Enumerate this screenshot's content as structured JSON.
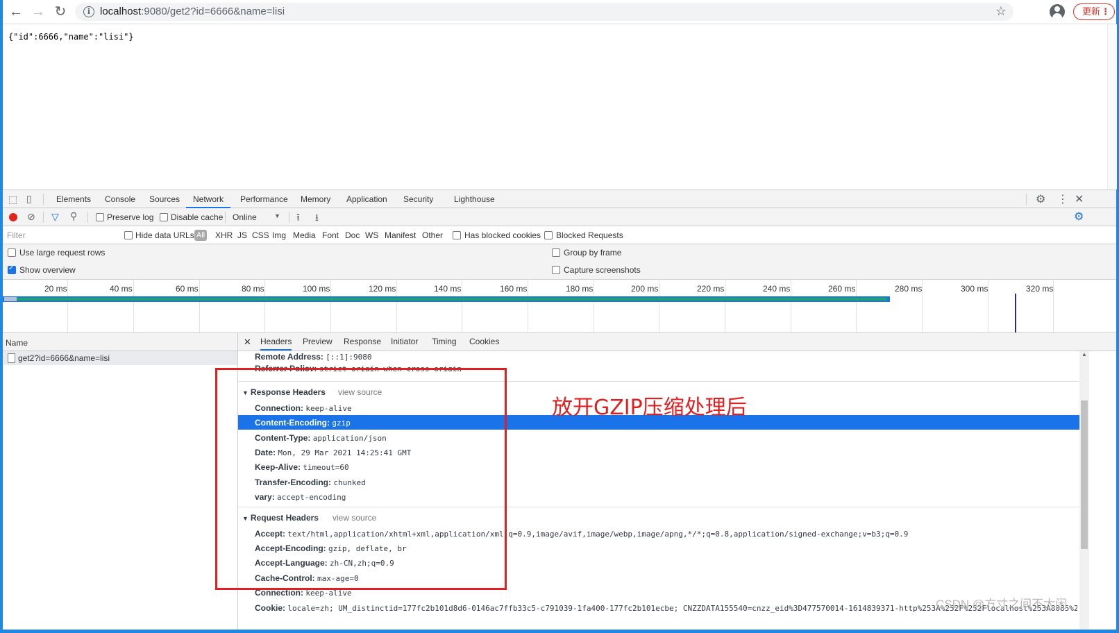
{
  "browser": {
    "url_host": "localhost",
    "url_rest": ":9080/get2?id=6666&name=lisi",
    "update_label": "更新"
  },
  "page": {
    "json_text": "{\"id\":6666,\"name\":\"lisi\"}"
  },
  "devtools": {
    "tabs": [
      "Elements",
      "Console",
      "Sources",
      "Network",
      "Performance",
      "Memory",
      "Application",
      "Security",
      "Lighthouse"
    ],
    "active_tab": "Network",
    "toolbar": {
      "preserve_log": "Preserve log",
      "disable_cache": "Disable cache",
      "throttle": "Online"
    },
    "filter": {
      "placeholder": "Filter",
      "hide_data_urls": "Hide data URLs",
      "types": [
        "All",
        "XHR",
        "JS",
        "CSS",
        "Img",
        "Media",
        "Font",
        "Doc",
        "WS",
        "Manifest",
        "Other"
      ],
      "has_blocked_cookies": "Has blocked cookies",
      "blocked_requests": "Blocked Requests"
    },
    "options": {
      "use_large_rows": "Use large request rows",
      "show_overview": "Show overview",
      "group_by_frame": "Group by frame",
      "capture_screenshots": "Capture screenshots"
    },
    "timeline_ticks": [
      "20 ms",
      "40 ms",
      "60 ms",
      "80 ms",
      "100 ms",
      "120 ms",
      "140 ms",
      "160 ms",
      "180 ms",
      "200 ms",
      "220 ms",
      "240 ms",
      "260 ms",
      "280 ms",
      "300 ms",
      "320 ms"
    ],
    "requests_header": "Name",
    "requests": [
      "get2?id=6666&name=lisi"
    ],
    "detail_tabs": [
      "Headers",
      "Preview",
      "Response",
      "Initiator",
      "Timing",
      "Cookies"
    ],
    "general_partial": [
      {
        "k": "Remote Address:",
        "v": "[::1]:9080"
      },
      {
        "k": "Referrer Policy:",
        "v": "strict-origin-when-cross-origin"
      }
    ],
    "response_headers_title": "Response Headers",
    "view_source": "view source",
    "response_headers": [
      {
        "k": "Connection:",
        "v": "keep-alive"
      },
      {
        "k": "Content-Encoding:",
        "v": "gzip"
      },
      {
        "k": "Content-Type:",
        "v": "application/json"
      },
      {
        "k": "Date:",
        "v": "Mon, 29 Mar 2021 14:25:41 GMT"
      },
      {
        "k": "Keep-Alive:",
        "v": "timeout=60"
      },
      {
        "k": "Transfer-Encoding:",
        "v": "chunked"
      },
      {
        "k": "vary:",
        "v": "accept-encoding"
      }
    ],
    "request_headers_title": "Request Headers",
    "request_headers": [
      {
        "k": "Accept:",
        "v": "text/html,application/xhtml+xml,application/xml;q=0.9,image/avif,image/webp,image/apng,*/*;q=0.8,application/signed-exchange;v=b3;q=0.9"
      },
      {
        "k": "Accept-Encoding:",
        "v": "gzip, deflate, br"
      },
      {
        "k": "Accept-Language:",
        "v": "zh-CN,zh;q=0.9"
      },
      {
        "k": "Cache-Control:",
        "v": "max-age=0"
      },
      {
        "k": "Connection:",
        "v": "keep-alive"
      },
      {
        "k": "Cookie:",
        "v": "locale=zh; UM_distinctid=177fc2b101d8d6-0146ac7ffb33c5-c791039-1fa400-177fc2b101ecbe; CNZZDATA155540=cnzz_eid%3D477570014-1614839371-http%253A%252F%252Flocalhost%253A8085%252F%2"
      }
    ]
  },
  "annotation": "放开GZIP压缩处理后",
  "watermark": "CSDN @方寸之间不太闲"
}
